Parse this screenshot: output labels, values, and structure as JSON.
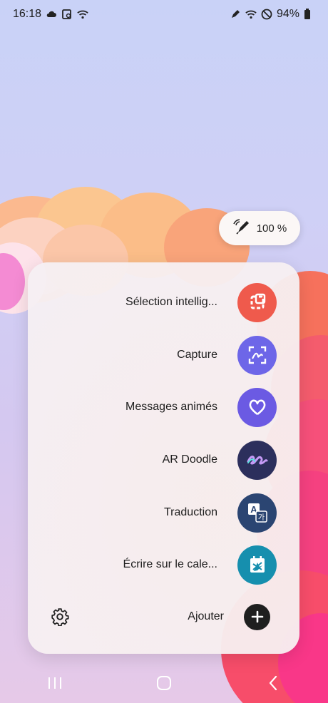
{
  "status_bar": {
    "time": "16:18",
    "battery": "94%",
    "left_icons": [
      "cloud-icon",
      "screenshot-icon",
      "wifi-share-icon"
    ],
    "right_icons": [
      "pen-icon",
      "wifi-icon",
      "dnd-icon",
      "battery-icon"
    ]
  },
  "pen_indicator": {
    "icon": "s-pen-icon",
    "battery": "100 %"
  },
  "air_command": {
    "items": [
      {
        "label": "Sélection intellig...",
        "icon": "smart-select-icon",
        "color": "#ef5a4c"
      },
      {
        "label": "Capture",
        "icon": "screen-write-icon",
        "color": "#6d66e8"
      },
      {
        "label": "Messages animés",
        "icon": "live-message-icon",
        "color": "#6b5ae3"
      },
      {
        "label": "AR Doodle",
        "icon": "ar-doodle-icon",
        "color": "#2c2f5c"
      },
      {
        "label": "Traduction",
        "icon": "translate-icon",
        "color": "#2b4572"
      },
      {
        "label": "Écrire sur le cale...",
        "icon": "calendar-write-icon",
        "color": "#168fae"
      }
    ],
    "add_label": "Ajouter",
    "settings_icon": "gear-icon"
  },
  "nav_bar": {
    "buttons": [
      "recent-apps-icon",
      "home-icon",
      "back-icon"
    ]
  }
}
